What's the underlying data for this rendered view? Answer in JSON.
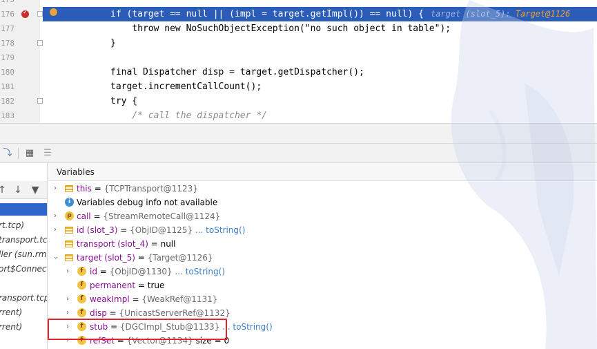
{
  "editor": {
    "lines": [
      {
        "num": "175",
        "code": ""
      },
      {
        "num": "176",
        "code": "if (target == null || (impl = target.getImpl()) == null) {",
        "hint_label": "target (slot_5): ",
        "hint_value": "Target@1126"
      },
      {
        "num": "177",
        "code": "    throw new NoSuchObjectException(\"no such object in table\");"
      },
      {
        "num": "178",
        "code": "}"
      },
      {
        "num": "179",
        "code": ""
      },
      {
        "num": "180",
        "code": "final Dispatcher disp = target.getDispatcher();"
      },
      {
        "num": "181",
        "code": "target.incrementCallCount();"
      },
      {
        "num": "182",
        "code": "try {"
      },
      {
        "num": "183",
        "code": "    /* call the dispatcher */"
      }
    ]
  },
  "frames": {
    "items": [
      "rt.tcp)",
      "transport.tcp",
      "ller (sun.rmi",
      "ort$Connect",
      "ransport.tcp",
      "rrent)",
      "rrent)"
    ]
  },
  "variables": {
    "title": "Variables",
    "rows": [
      {
        "name": "this",
        "eq": " = ",
        "value": "{TCPTransport@1123}"
      },
      {
        "info": "Variables debug info not available"
      },
      {
        "name": "call",
        "eq": " = ",
        "value": "{StreamRemoteCall@1124}"
      },
      {
        "name": "id (slot_3)",
        "eq": " = ",
        "value": "{ObjID@1125}",
        "link": "... toString()"
      },
      {
        "name": "transport (slot_4)",
        "eq": " = ",
        "value": "null"
      },
      {
        "name": "target (slot_5)",
        "eq": " = ",
        "value": "{Target@1126}"
      },
      {
        "name": "id",
        "eq": " = ",
        "value": "{ObjID@1130}",
        "link": "... toString()"
      },
      {
        "name": "permanent",
        "eq": " = ",
        "value": "true"
      },
      {
        "name": "weakImpl",
        "eq": " = ",
        "value": "{WeakRef@1131}"
      },
      {
        "name": "disp",
        "eq": " = ",
        "value": "{UnicastServerRef@1132}"
      },
      {
        "name": "stub",
        "eq": " = ",
        "value": "{DGCImpl_Stub@1133}",
        "link": "... toString()"
      },
      {
        "name": "refSet",
        "eq": " = ",
        "value": "{Vector@1134}",
        "extra": "  size = 0"
      }
    ]
  },
  "colors": {
    "current_line": "#2a5cb8",
    "breakpoint": "#c62f2f",
    "highlight_box": "#e0262c"
  }
}
